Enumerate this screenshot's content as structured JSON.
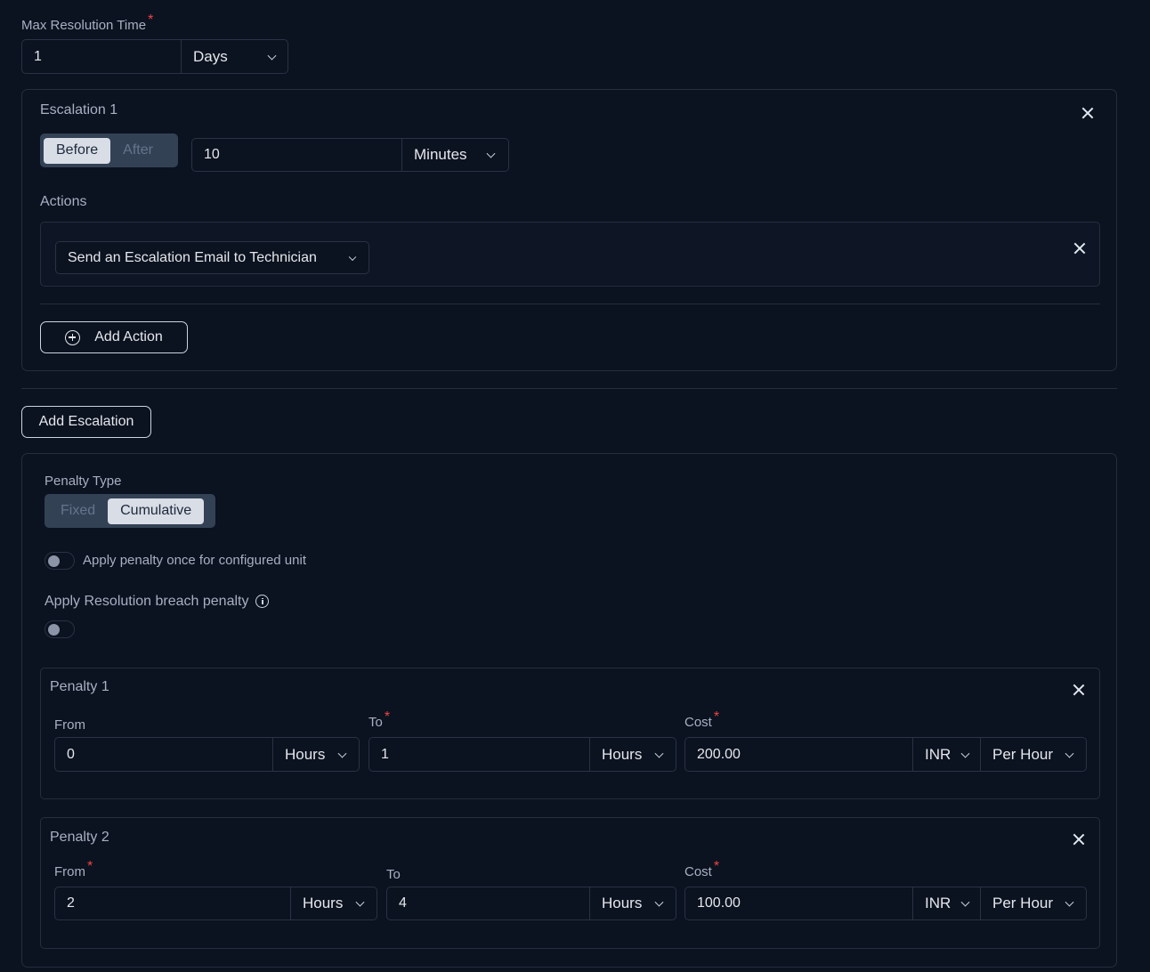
{
  "max_resolution": {
    "label": "Max Resolution Time",
    "required": "*",
    "value": "1",
    "unit": "Days"
  },
  "escalation": {
    "title": "Escalation 1",
    "segment": {
      "before": "Before",
      "after": "After",
      "selected": "Before"
    },
    "value": "10",
    "unit": "Minutes",
    "actions_label": "Actions",
    "action": "Send an Escalation Email to Technician",
    "add_action": "Add Action"
  },
  "add_escalation": "Add Escalation",
  "penalty_section": {
    "type_label": "Penalty Type",
    "segment": {
      "fixed": "Fixed",
      "cumulative": "Cumulative",
      "selected": "Cumulative"
    },
    "apply_once_label": "Apply penalty once for configured unit",
    "apply_once_on": false,
    "breach_label": "Apply Resolution breach penalty",
    "breach_on": false
  },
  "penalties": [
    {
      "title": "Penalty 1",
      "from_label": "From",
      "from_value": "0",
      "from_unit": "Hours",
      "to_label": "To",
      "to_value": "1",
      "to_unit": "Hours",
      "cost_label": "Cost",
      "cost_value": "200.00",
      "currency": "INR",
      "rate": "Per Hour"
    },
    {
      "title": "Penalty 2",
      "from_label": "From",
      "from_value": "2",
      "from_unit": "Hours",
      "to_label": "To",
      "to_value": "4",
      "to_unit": "Hours",
      "cost_label": "Cost",
      "cost_value": "100.00",
      "currency": "INR",
      "rate": "Per Hour"
    }
  ],
  "colors": {
    "background": "#0b1220",
    "required": "#ef4444",
    "border": "#252e3d"
  }
}
